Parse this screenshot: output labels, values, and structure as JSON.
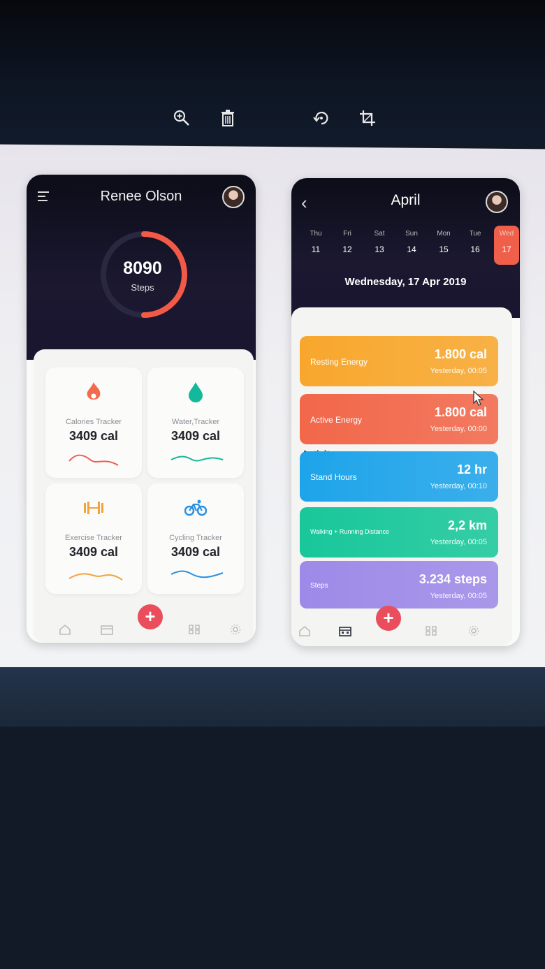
{
  "toolbar": {
    "zoom_icon": "zoom-in-icon",
    "delete_icon": "trash-icon",
    "rotate_icon": "rotate-icon",
    "crop_icon": "crop-icon"
  },
  "left_phone": {
    "user_name": "Renee Olson",
    "steps_value": "8090",
    "steps_label": "Steps",
    "ring_progress": 0.5,
    "tiles": [
      {
        "label": "Calories Tracker",
        "value": "3409 cal",
        "icon": "flame-icon",
        "color": "#f26b4f"
      },
      {
        "label": "Water,Tracker",
        "value": "3409 cal",
        "icon": "water-drop-icon",
        "color": "#14b89a"
      },
      {
        "label": "Exercise Tracker",
        "value": "3409 cal",
        "icon": "dumbbell-icon",
        "color": "#f4a23a"
      },
      {
        "label": "Cycling Tracker",
        "value": "3409 cal",
        "icon": "bicycle-icon",
        "color": "#2a90e0"
      }
    ],
    "fab_label": "+"
  },
  "right_phone": {
    "month": "April",
    "days": [
      {
        "name": "Thu",
        "date": "11",
        "selected": false
      },
      {
        "name": "Fri",
        "date": "12",
        "selected": false
      },
      {
        "name": "Sat",
        "date": "13",
        "selected": false
      },
      {
        "name": "Sun",
        "date": "14",
        "selected": false
      },
      {
        "name": "Mon",
        "date": "15",
        "selected": false
      },
      {
        "name": "Tue",
        "date": "16",
        "selected": false
      },
      {
        "name": "Wed",
        "date": "17",
        "selected": true
      }
    ],
    "date_full": "Wednesday, 17 Apr 2019",
    "activity_label": "Activity",
    "activities": [
      {
        "name": "Resting Energy",
        "value": "1.800 cal",
        "time": "Yesterday, 00:05",
        "color": "#f8a72c"
      },
      {
        "name": "Active Energy",
        "value": "1.800 cal",
        "time": "Yesterday, 00:00",
        "color": "#f2674a"
      },
      {
        "name": "Stand Hours",
        "value": "12 hr",
        "time": "Yesterday, 00:10",
        "color": "#1ea4ea"
      },
      {
        "name": "Walking + Running Distance",
        "value": "2,2 km",
        "time": "Yesterday, 00:05",
        "color": "#18c79a"
      },
      {
        "name": "Steps",
        "value": "3.234 steps",
        "time": "Yesterday, 00:05",
        "color": "#9d8ae8"
      }
    ],
    "fab_label": "+"
  }
}
